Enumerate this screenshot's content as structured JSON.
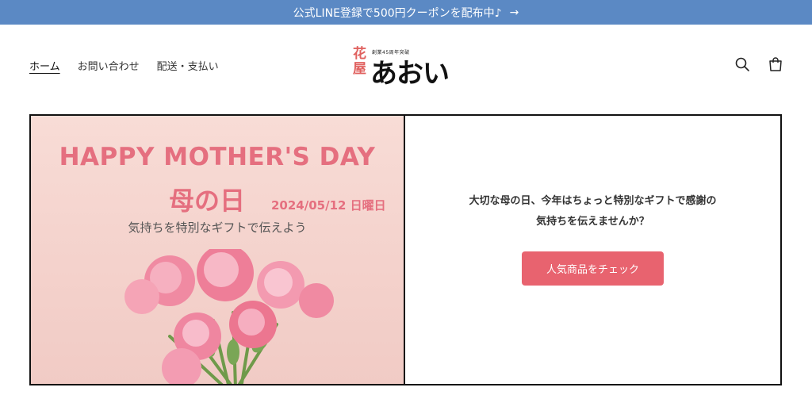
{
  "announcement": {
    "text": "公式LINE登録で500円クーポンを配布中♪",
    "arrow": "→"
  },
  "nav": {
    "items": [
      {
        "label": "ホーム",
        "active": true
      },
      {
        "label": "お問い合わせ"
      },
      {
        "label": "配送・支払い"
      }
    ]
  },
  "logo": {
    "kanji_top": "花",
    "kanji_bottom": "屋",
    "name": "あおい",
    "tagline": "創業45周年突破"
  },
  "header_icons": [
    "search-icon",
    "cart-icon"
  ],
  "banner": {
    "headline": "HAPPY MOTHER'S  DAY",
    "title": "母の日",
    "date": "2024/05/12 日曜日",
    "subtitle": "気持ちを特別なギフトで伝えよう",
    "message_line1": "大切な母の日、今年はちょっと特別なギフトで感謝の",
    "message_line2": "気持ちを伝えませんか？",
    "cta_label": "人気商品をチェック"
  },
  "colors": {
    "announce_bg": "#5b89c4",
    "accent": "#e8636f",
    "banner_text": "#e56f7f"
  }
}
